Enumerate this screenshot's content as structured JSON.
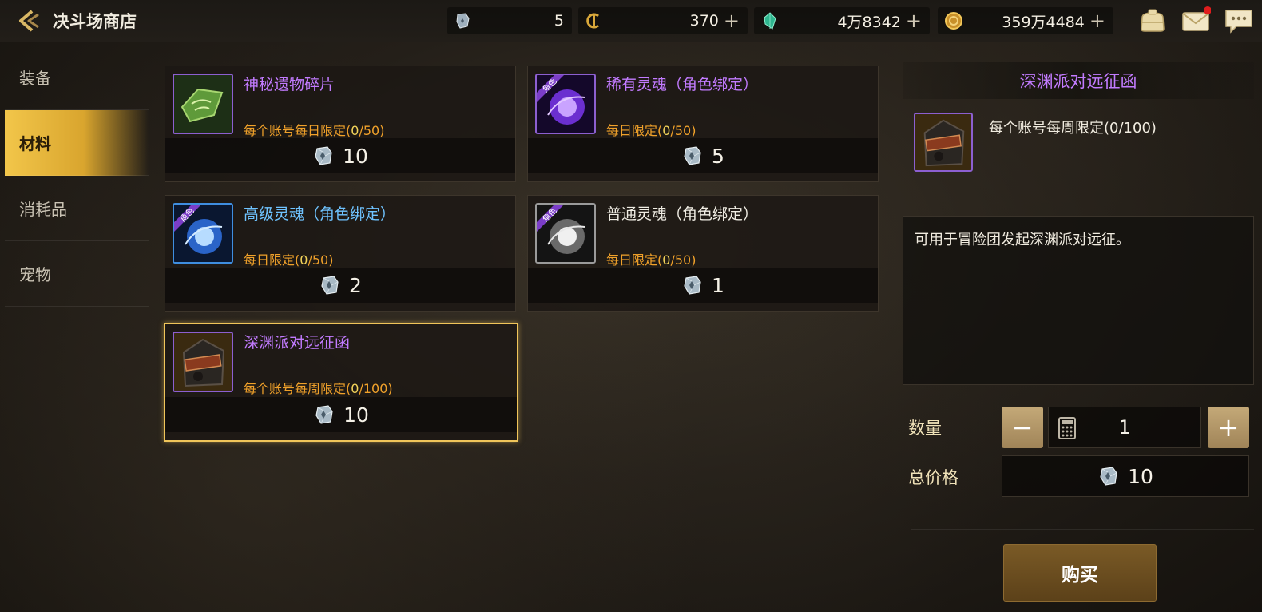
{
  "header": {
    "title": "决斗场商店"
  },
  "currencies": [
    {
      "icon": "duel-token-icon",
      "value": "5",
      "has_plus": false
    },
    {
      "icon": "c-coin-icon",
      "value": "370",
      "has_plus": true
    },
    {
      "icon": "green-crystal-icon",
      "value": "4万8342",
      "has_plus": true
    },
    {
      "icon": "gold-coin-icon",
      "value": "359万4484",
      "has_plus": true
    }
  ],
  "plus_symbol": "+",
  "sidebar": {
    "items": [
      {
        "label": "装备",
        "active": false
      },
      {
        "label": "材料",
        "active": true
      },
      {
        "label": "消耗品",
        "active": false
      },
      {
        "label": "宠物",
        "active": false
      }
    ]
  },
  "items": [
    {
      "name": "神秘遗物碎片",
      "limit_prefix": "每个账号每日限定(",
      "limit_current": "0",
      "limit_suffix": "/50)",
      "price": "10",
      "color": "#c27bff",
      "badge": ""
    },
    {
      "name": "稀有灵魂（角色绑定）",
      "limit_prefix": "每日限定(",
      "limit_current": "0",
      "limit_suffix": "/50)",
      "price": "5",
      "color": "#c27bff",
      "badge": "角色"
    },
    {
      "name": "高级灵魂（角色绑定）",
      "limit_prefix": "每日限定(",
      "limit_current": "0",
      "limit_suffix": "/50)",
      "price": "2",
      "color": "#6fc3ff",
      "badge": "角色"
    },
    {
      "name": "普通灵魂（角色绑定）",
      "limit_prefix": "每日限定(",
      "limit_current": "0",
      "limit_suffix": "/50)",
      "price": "1",
      "color": "#f0ede4",
      "badge": "角色"
    },
    {
      "name": "深渊派对远征函",
      "limit_prefix": "每个账号每周限定(",
      "limit_current": "0",
      "limit_suffix": "/100)",
      "price": "10",
      "color": "#c27bff",
      "badge": ""
    }
  ],
  "detail": {
    "title": "深渊派对远征函",
    "limit": "每个账号每周限定(0/100)",
    "description": "可用于冒险团发起深渊派对远征。",
    "quantity_label": "数量",
    "quantity": "1",
    "minus_label": "−",
    "plus_label": "+",
    "total_label": "总价格",
    "total": "10",
    "buy_label": "购买"
  }
}
